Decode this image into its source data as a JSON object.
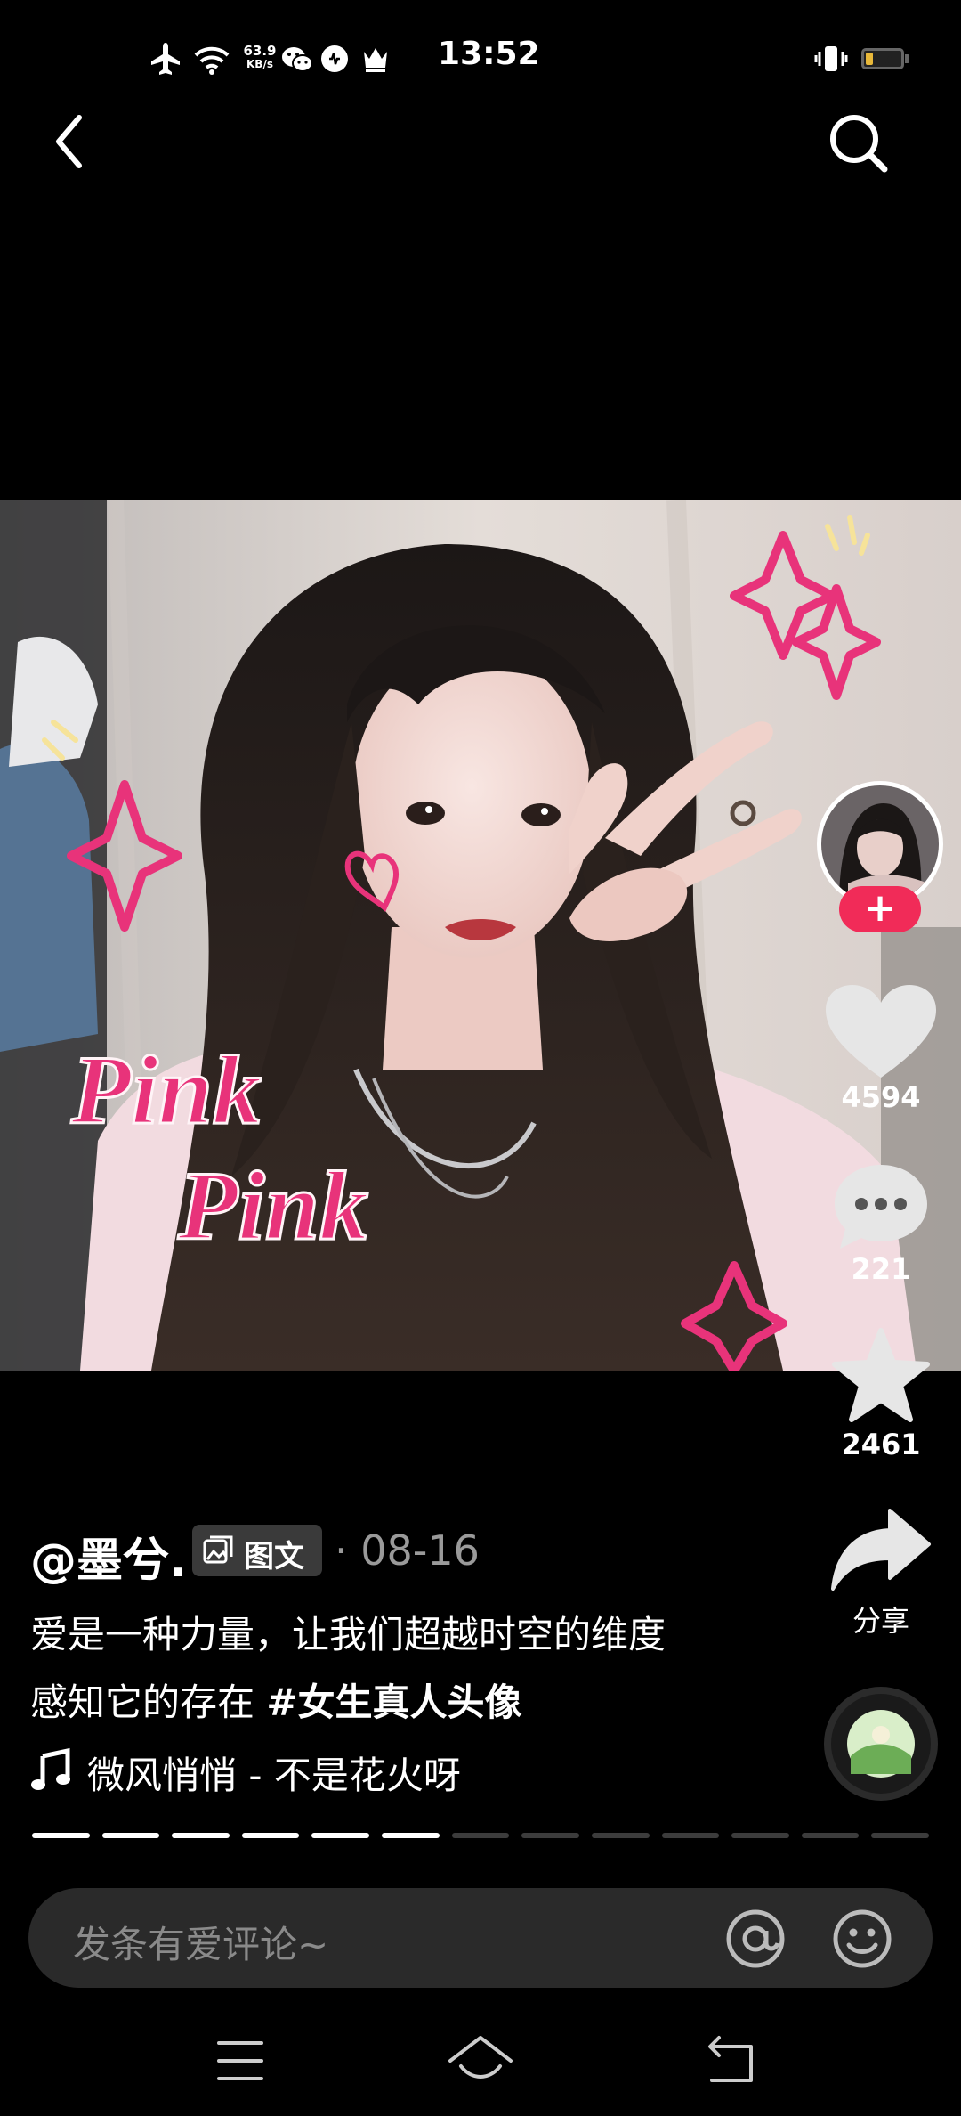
{
  "status_bar": {
    "time": "13:52",
    "net_speed_value": "63.9",
    "net_speed_unit": "KB/s",
    "battery_level": "17",
    "icons": [
      "airplane-icon",
      "wifi-icon",
      "wechat-icon",
      "app-icon",
      "crown-icon",
      "vibrate-icon",
      "battery-icon"
    ]
  },
  "top_nav": {
    "back_icon": "back-arrow-icon",
    "search_icon": "search-icon"
  },
  "actions": {
    "follow_label": "+",
    "likes": "4594",
    "comments": "221",
    "favorites": "2461",
    "share_label": "分享"
  },
  "post": {
    "author": "@墨兮.",
    "type_tag": "图文",
    "separator": "·",
    "date": "08-16",
    "description_line1": "爱是一种力量，让我们超越时空的维度",
    "description_line2": "感知它的存在 ",
    "hashtag": "#女生真人头像",
    "music": "微风悄悄 - 不是花火呀",
    "image_count": 13,
    "current_image": 6
  },
  "comment_bar": {
    "placeholder": "发条有爱评论~"
  },
  "colors": {
    "background": "#000000",
    "accent": "#f12b58",
    "muted": "#9a9a9a"
  }
}
